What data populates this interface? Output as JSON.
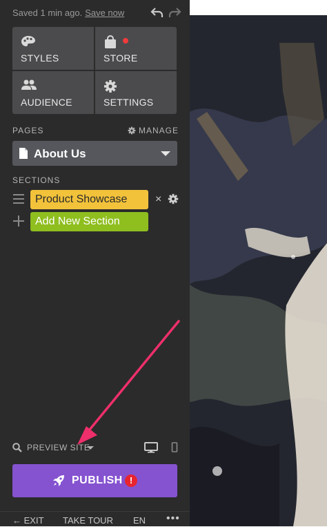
{
  "topbar": {
    "saved_text": "Saved 1 min ago.",
    "save_now": "Save now",
    "undo_icon": "undo-icon",
    "redo_icon": "redo-icon"
  },
  "tiles": [
    {
      "label": "STYLES",
      "icon": "palette-icon"
    },
    {
      "label": "STORE",
      "icon": "shopping-bag-icon",
      "badge_color": "#ee3b3b"
    },
    {
      "label": "AUDIENCE",
      "icon": "people-icon"
    },
    {
      "label": "SETTINGS",
      "icon": "gear-icon"
    }
  ],
  "pages": {
    "label": "PAGES",
    "manage_label": "MANAGE",
    "selected_page": "About Us"
  },
  "sections": {
    "label": "SECTIONS",
    "items": [
      {
        "label": "Product Showcase",
        "color": "#f2c23a"
      }
    ],
    "add_label": "Add New Section",
    "add_color": "#8fbe1f",
    "remove_symbol": "×"
  },
  "preview": {
    "label": "PREVIEW SITE"
  },
  "publish": {
    "label": "PUBLISH",
    "color": "#8553d0",
    "warning_symbol": "!"
  },
  "footer": {
    "exit_label": "EXIT",
    "tour_label": "TAKE TOUR",
    "language": "EN",
    "more": "•••"
  },
  "colors": {
    "sidebar_bg": "#2b2b2b",
    "annotation_arrow": "#ee2f6b"
  }
}
